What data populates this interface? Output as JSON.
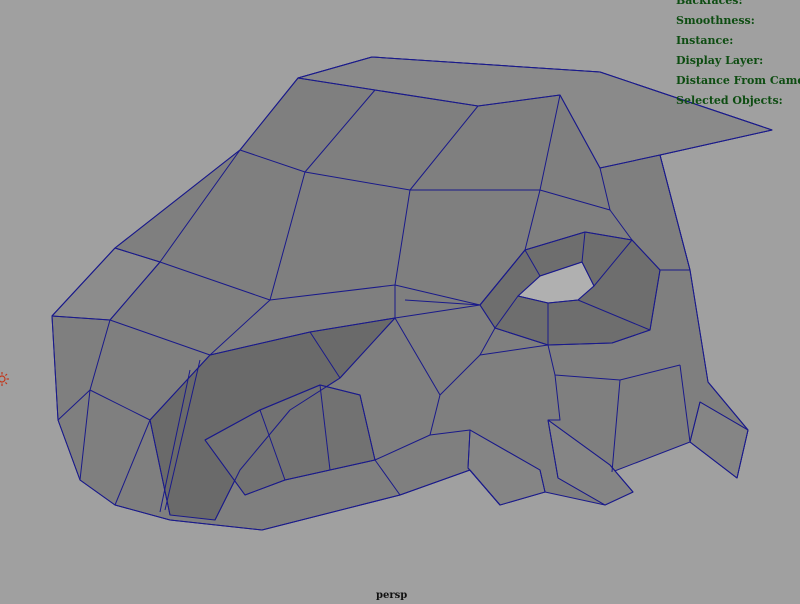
{
  "viewport": {
    "camera_name": "persp",
    "background_color": "#a0a0a0",
    "mesh_fill_color": "#7e7e7e",
    "wireframe_color": "#1a1a8a"
  },
  "hud": {
    "items": [
      "Backfaces:",
      "Smoothness:",
      "Instance:",
      "Display Layer:",
      "Distance From Camera:",
      "Selected Objects:"
    ],
    "text_color": "#0e4d12"
  },
  "icons": {
    "light": "sun-icon",
    "light_color": "#c2361a"
  }
}
